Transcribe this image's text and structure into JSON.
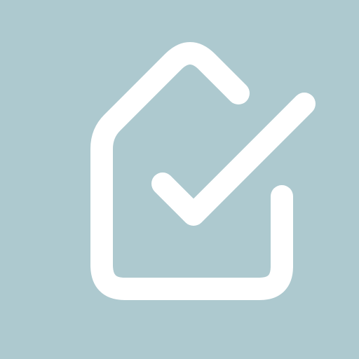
{
  "icon": {
    "name": "house-check-icon",
    "background_color": "#adc9cf",
    "stroke_color": "#ffffff"
  }
}
